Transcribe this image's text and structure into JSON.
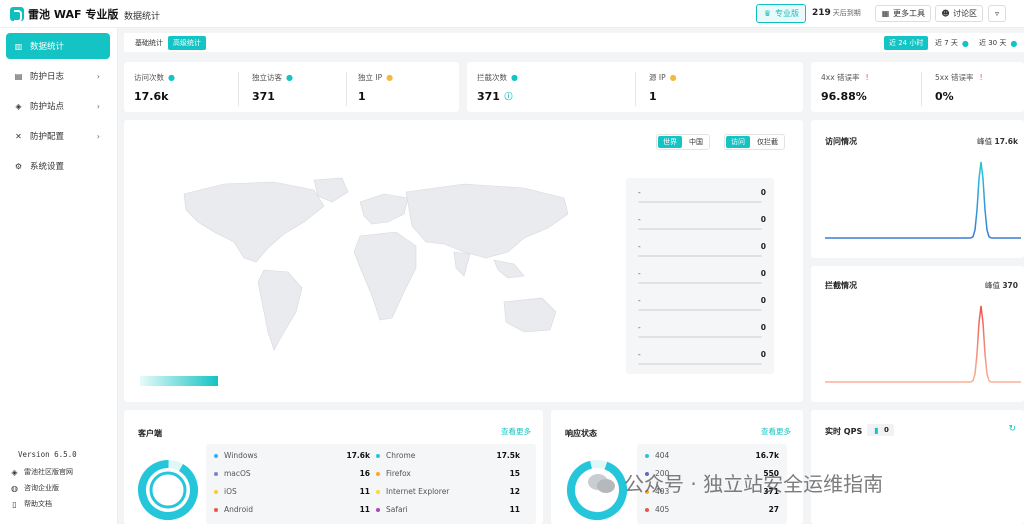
{
  "app": {
    "name": "雷池 WAF 专业版"
  },
  "header": {
    "page_title": "数据统计",
    "pro_label": "专业版",
    "days_count": "219",
    "days_text": "天后到期",
    "tools_label": "更多工具",
    "forum_label": "讨论区"
  },
  "sidebar": {
    "items": [
      {
        "label": "数据统计"
      },
      {
        "label": "防护日志"
      },
      {
        "label": "防护站点"
      },
      {
        "label": "防护配置"
      },
      {
        "label": "系统设置"
      }
    ],
    "version": "Version 6.5.0",
    "links": [
      {
        "label": "雷池社区版官网"
      },
      {
        "label": "咨询企业版"
      },
      {
        "label": "帮助文档"
      }
    ]
  },
  "tabs": [
    {
      "label": "基础统计"
    },
    {
      "label": "高级统计"
    }
  ],
  "ranges": [
    {
      "label": "近 24 小时"
    },
    {
      "label": "近 7 天"
    },
    {
      "label": "近 30 天"
    }
  ],
  "stats": [
    {
      "label": "访问次数",
      "value": "17.6k"
    },
    {
      "label": "独立访客",
      "value": "371"
    },
    {
      "label": "独立 IP",
      "value": "1"
    },
    {
      "label": "拦截次数",
      "value": "371"
    },
    {
      "label": "源 IP",
      "value": "1"
    },
    {
      "label": "4xx 错误率",
      "value": "96.88%"
    },
    {
      "label": "5xx 错误率",
      "value": "0%"
    }
  ],
  "map": {
    "scope": [
      {
        "label": "世界"
      },
      {
        "label": "中国"
      }
    ],
    "mode": [
      {
        "label": "访问"
      },
      {
        "label": "仅拦截"
      }
    ],
    "rank": [
      {
        "name": "-",
        "value": "0"
      },
      {
        "name": "-",
        "value": "0"
      },
      {
        "name": "-",
        "value": "0"
      },
      {
        "name": "-",
        "value": "0"
      },
      {
        "name": "-",
        "value": "0"
      },
      {
        "name": "-",
        "value": "0"
      },
      {
        "name": "-",
        "value": "0"
      }
    ]
  },
  "visits": {
    "title": "访问情况",
    "peak_label": "峰值",
    "peak_value": "17.6k",
    "color": "#3a7bd5"
  },
  "blocks": {
    "title": "拦截情况",
    "peak_label": "峰值",
    "peak_value": "370",
    "color": "#f28b82"
  },
  "clients": {
    "title": "客户端",
    "more": "查看更多",
    "os": [
      {
        "name": "Windows",
        "value": "17.6k",
        "color": "#29b6f6"
      },
      {
        "name": "macOS",
        "value": "16",
        "color": "#7986cb"
      },
      {
        "name": "iOS",
        "value": "11",
        "color": "#ffca28"
      },
      {
        "name": "Android",
        "value": "11",
        "color": "#ef5350"
      }
    ],
    "browser": [
      {
        "name": "Chrome",
        "value": "17.5k",
        "color": "#26c6da"
      },
      {
        "name": "Firefox",
        "value": "15",
        "color": "#ffa726"
      },
      {
        "name": "Internet Explorer",
        "value": "12",
        "color": "#fdd835"
      },
      {
        "name": "Safari",
        "value": "11",
        "color": "#ab47bc"
      }
    ]
  },
  "responses": {
    "title": "响应状态",
    "more": "查看更多",
    "items": [
      {
        "code": "404",
        "value": "16.7k",
        "color": "#26c6da"
      },
      {
        "code": "200",
        "value": "550",
        "color": "#5c6bc0"
      },
      {
        "code": "403",
        "value": "371",
        "color": "#ffa726"
      },
      {
        "code": "405",
        "value": "27",
        "color": "#ef5350"
      }
    ]
  },
  "qps": {
    "title": "实时 QPS",
    "value": "0"
  },
  "watermark": "公众号 · 独立站安全运维指南"
}
